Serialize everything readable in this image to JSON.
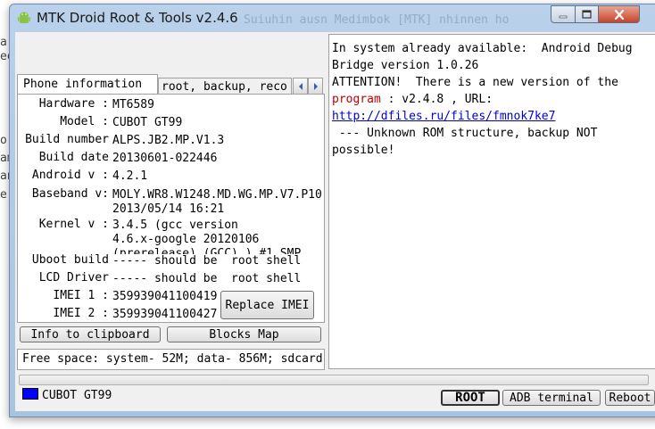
{
  "background": {
    "fragment_left_1": "ar",
    "fragment_left_2": "ee",
    "fragment_left_3": "o",
    "fragment_left_4": "am",
    "fragment_left_5": "an",
    "fragment_left_6": "er",
    "title_ghost": "Suiuhin ausn Medimbok [MTK] nhinnen ho"
  },
  "window": {
    "title": "MTK Droid Root & Tools v2.4.6",
    "accent": "#b9d1ea"
  },
  "tabs": {
    "active": "Phone information",
    "inactive": "root, backup, reco"
  },
  "phone_info": {
    "hardware_label": "Hardware :",
    "hardware_value": "MT6589",
    "model_label": "Model :",
    "model_value": "CUBOT GT99",
    "build_number_label": "Build number",
    "build_number_value": "ALPS.JB2.MP.V1.3",
    "build_date_label": "Build date",
    "build_date_value": "20130601-022446",
    "android_label": "Android  v :",
    "android_value": "4.2.1",
    "baseband_label": "Baseband v:",
    "baseband_value": "MOLY.WR8.W1248.MD.WG.MP.V7.P10\n2013/05/14 16:21",
    "kernel_label": "Kernel v :",
    "kernel_value": "3.4.5 (gcc version\n4.6.x-google 20120106\n(prerelease) (GCC) ) #1 SMP",
    "uboot_label": "Uboot build",
    "uboot_value": "----- should be  root shell",
    "lcd_label": "LCD Driver",
    "lcd_value": "----- should be  root shell",
    "imei1_label": "IMEI 1 :",
    "imei1_value": "359939041100419",
    "imei2_label": "IMEI 2 :",
    "imei2_value": "359939041100427"
  },
  "buttons": {
    "replace_imei": "Replace IMEI",
    "info_to_clipboard": "Info to clipboard",
    "blocks_map": "Blocks Map",
    "root": "ROOT",
    "adb_terminal": "ADB terminal",
    "reboot": "Reboot"
  },
  "free_space": "Free space: system- 52M; data- 856M; sdcard",
  "log": {
    "line1": "In system already available:  Android Debug",
    "line2": "Bridge version 1.0.26",
    "line3": "ATTENTION!  There is a new version of the",
    "line4_red": "program",
    "line4_rest": " : v2.4.8 , URL:",
    "link": "http://dfiles.ru/files/fmnok7ke7",
    "line6": " --- Unknown ROM structure, backup NOT",
    "line7": "possible!"
  },
  "status": {
    "device": "CUBOT GT99",
    "indicator_color": "#0000ff"
  }
}
